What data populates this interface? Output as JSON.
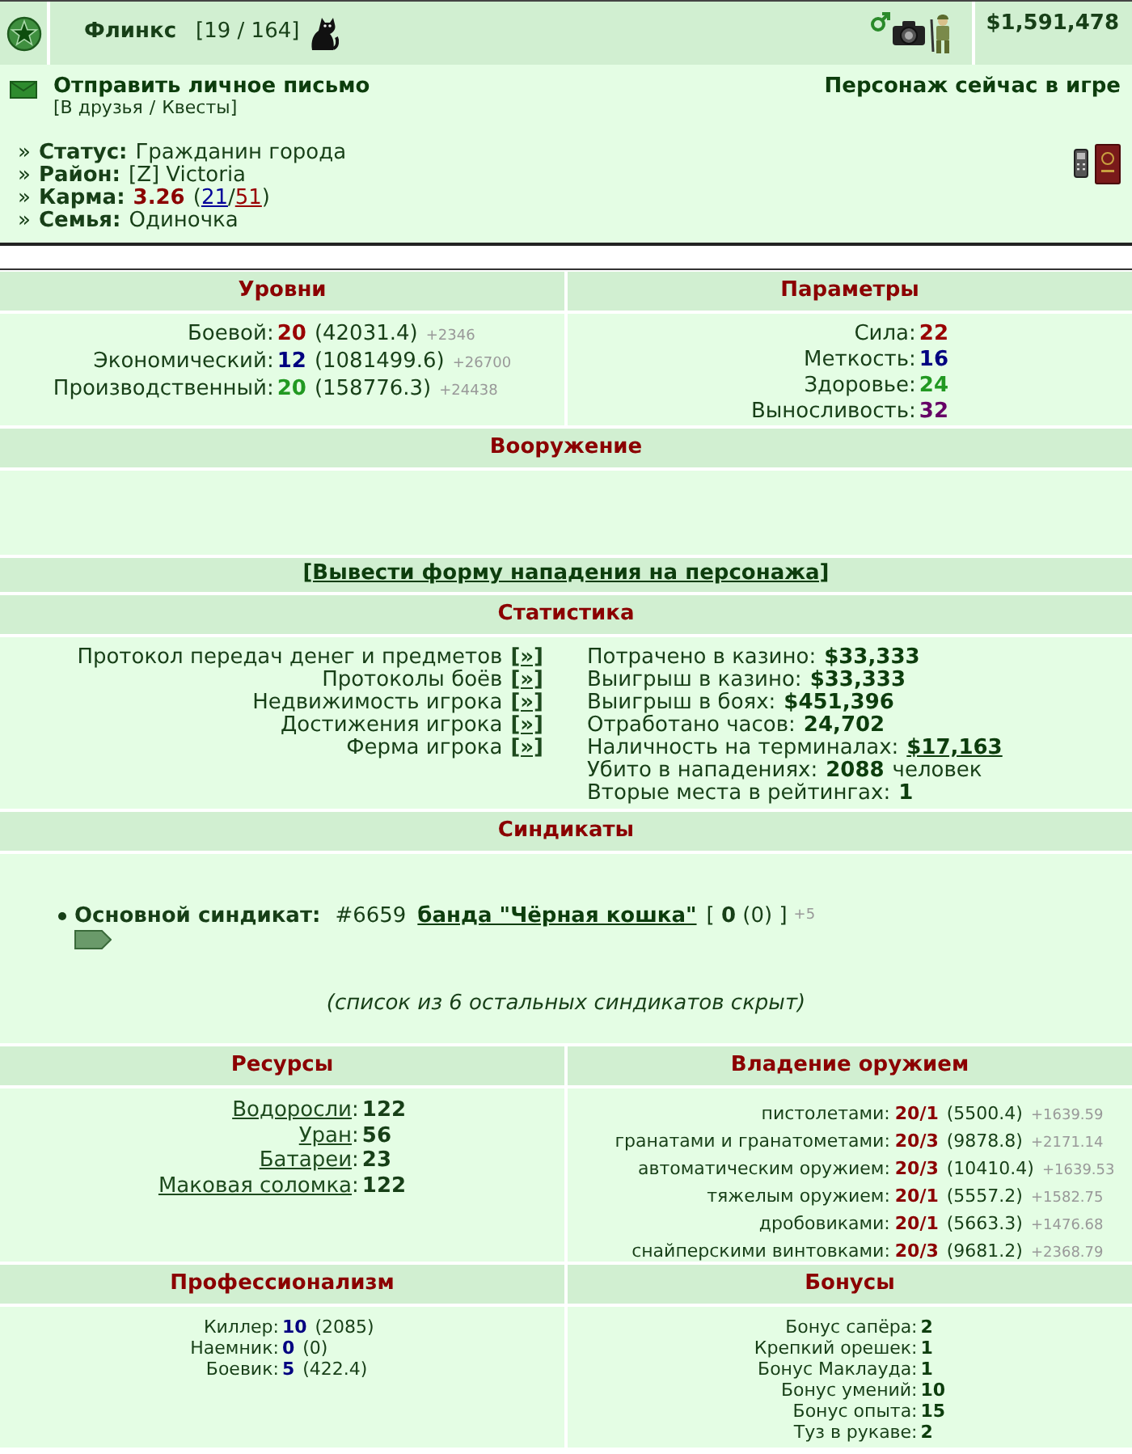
{
  "header": {
    "name": "Флинкс",
    "rank": "[19 / 164]",
    "money": "$1,591,478"
  },
  "contact": {
    "send_message": "Отправить личное письмо",
    "links_open": "[",
    "links": [
      "В друзья",
      "Квесты"
    ],
    "links_separator": "/",
    "links_close": "]",
    "presence": "Персонаж сейчас в игре"
  },
  "profile": [
    {
      "kind": "text",
      "marker": "»",
      "label": "Статус:",
      "value": "Гражданин города"
    },
    {
      "kind": "text",
      "marker": "»",
      "label": "Район:",
      "value": "[Z] Victoria"
    },
    {
      "kind": "karma",
      "marker": "»",
      "label": "Карма:",
      "value": "3.26",
      "votes": [
        {
          "kind": "text",
          "text": "("
        },
        {
          "kind": "link",
          "text": "21",
          "color": "#000099"
        },
        {
          "kind": "text",
          "text": "/"
        },
        {
          "kind": "link",
          "text": "51",
          "color": "#990000"
        },
        {
          "kind": "text",
          "text": ")"
        }
      ]
    },
    {
      "kind": "text",
      "marker": "»",
      "label": "Семья:",
      "value": "Одиночка"
    }
  ],
  "levels": {
    "title": "Уровни",
    "items": [
      {
        "label": "Боевой:",
        "value": "20",
        "color": "#990000",
        "points": "(42031.4)",
        "gain": "+2346"
      },
      {
        "label": "Экономический:",
        "value": "12",
        "color": "#000080",
        "points": "(1081499.6)",
        "gain": "+26700"
      },
      {
        "label": "Производственный:",
        "value": "20",
        "color": "#229922",
        "points": "(158776.3)",
        "gain": "+24438"
      }
    ]
  },
  "parameters": {
    "title": "Параметры",
    "items": [
      {
        "label": "Сила:",
        "value": "22",
        "color": "#990000"
      },
      {
        "label": "Меткость:",
        "value": "16",
        "color": "#000080"
      },
      {
        "label": "Здоровье:",
        "value": "24",
        "color": "#229922"
      },
      {
        "label": "Выносливость:",
        "value": "32",
        "color": "#660066"
      }
    ]
  },
  "armament": {
    "title": "Вооружение"
  },
  "attack_link": "[Вывести форму нападения на персонажа]",
  "statistics": {
    "title": "Статистика",
    "protocols": [
      {
        "label": "Протокол передач денег и предметов",
        "link": "[»]"
      },
      {
        "label": "Протоколы боёв",
        "link": "[»]"
      },
      {
        "label": "Недвижимость игрока",
        "link": "[»]"
      },
      {
        "label": "Достижения игрока",
        "link": "[»]"
      },
      {
        "label": "Ферма игрока",
        "link": "[»]"
      }
    ],
    "facts": [
      {
        "kind": "plain",
        "label": "Потрачено в казино:",
        "value": "$33,333"
      },
      {
        "kind": "plain",
        "label": "Выигрыш в казино:",
        "value": "$33,333"
      },
      {
        "kind": "plain",
        "label": "Выигрыш в боях:",
        "value": "$451,396"
      },
      {
        "kind": "plain",
        "label": "Отработано часов:",
        "value": "24,702"
      },
      {
        "kind": "link",
        "label": "Наличность на терминалах:",
        "value": "$17,163"
      },
      {
        "kind": "plain",
        "label": "Убито в нападениях:",
        "value": "2088",
        "suffix": "человек"
      },
      {
        "kind": "plain",
        "label": "Вторые места в рейтингах:",
        "value": "1"
      }
    ]
  },
  "syndicates": {
    "title": "Синдикаты",
    "main": {
      "label": "Основной синдикат:",
      "number": "#6659",
      "name": "банда \"Чёрная кошка\"",
      "members": "[ **0** (0) ]",
      "gain": "+5"
    },
    "hidden_note": "(список из 6 остальных синдикатов скрыт)"
  },
  "resources": {
    "title": "Ресурсы",
    "items": [
      {
        "name": "Водоросли",
        "suffix": ":",
        "value": "122"
      },
      {
        "name": "Уран",
        "suffix": ":",
        "value": "56"
      },
      {
        "name": "Батареи",
        "suffix": ":",
        "value": "23"
      },
      {
        "name": "Маковая соломка",
        "suffix": ":",
        "value": "122"
      }
    ]
  },
  "weapon_mastery": {
    "title": "Владение оружием",
    "items": [
      {
        "label": "пистолетами:",
        "value": "20/1",
        "points": "(5500.4)",
        "gain": "+1639.59"
      },
      {
        "label": "гранатами и гранатометами:",
        "value": "20/3",
        "points": "(9878.8)",
        "gain": "+2171.14"
      },
      {
        "label": "автоматическим оружием:",
        "value": "20/3",
        "points": "(10410.4)",
        "gain": "+1639.53"
      },
      {
        "label": "тяжелым оружием:",
        "value": "20/1",
        "points": "(5557.2)",
        "gain": "+1582.75"
      },
      {
        "label": "дробовиками:",
        "value": "20/1",
        "points": "(5663.3)",
        "gain": "+1476.68"
      },
      {
        "label": "снайперскими винтовками:",
        "value": "20/3",
        "points": "(9681.2)",
        "gain": "+2368.79"
      }
    ]
  },
  "professionalism": {
    "title": "Профессионализм",
    "items": [
      {
        "label": "Киллер:",
        "value": "10",
        "points": "(2085)"
      },
      {
        "label": "Наемник:",
        "value": "0",
        "points": "(0)"
      },
      {
        "label": "Боевик:",
        "value": "5",
        "points": "(422.4)"
      }
    ]
  },
  "bonuses": {
    "title": "Бонусы",
    "items": [
      {
        "label": "Бонус сапёра:",
        "value": "2"
      },
      {
        "label": "Крепкий орешек:",
        "value": "1"
      },
      {
        "label": "Бонус Маклауда:",
        "value": "1"
      },
      {
        "label": "Бонус умений:",
        "value": "10"
      },
      {
        "label": "Бонус опыта:",
        "value": "15"
      },
      {
        "label": "Туз в рукаве:",
        "value": "2"
      }
    ]
  }
}
